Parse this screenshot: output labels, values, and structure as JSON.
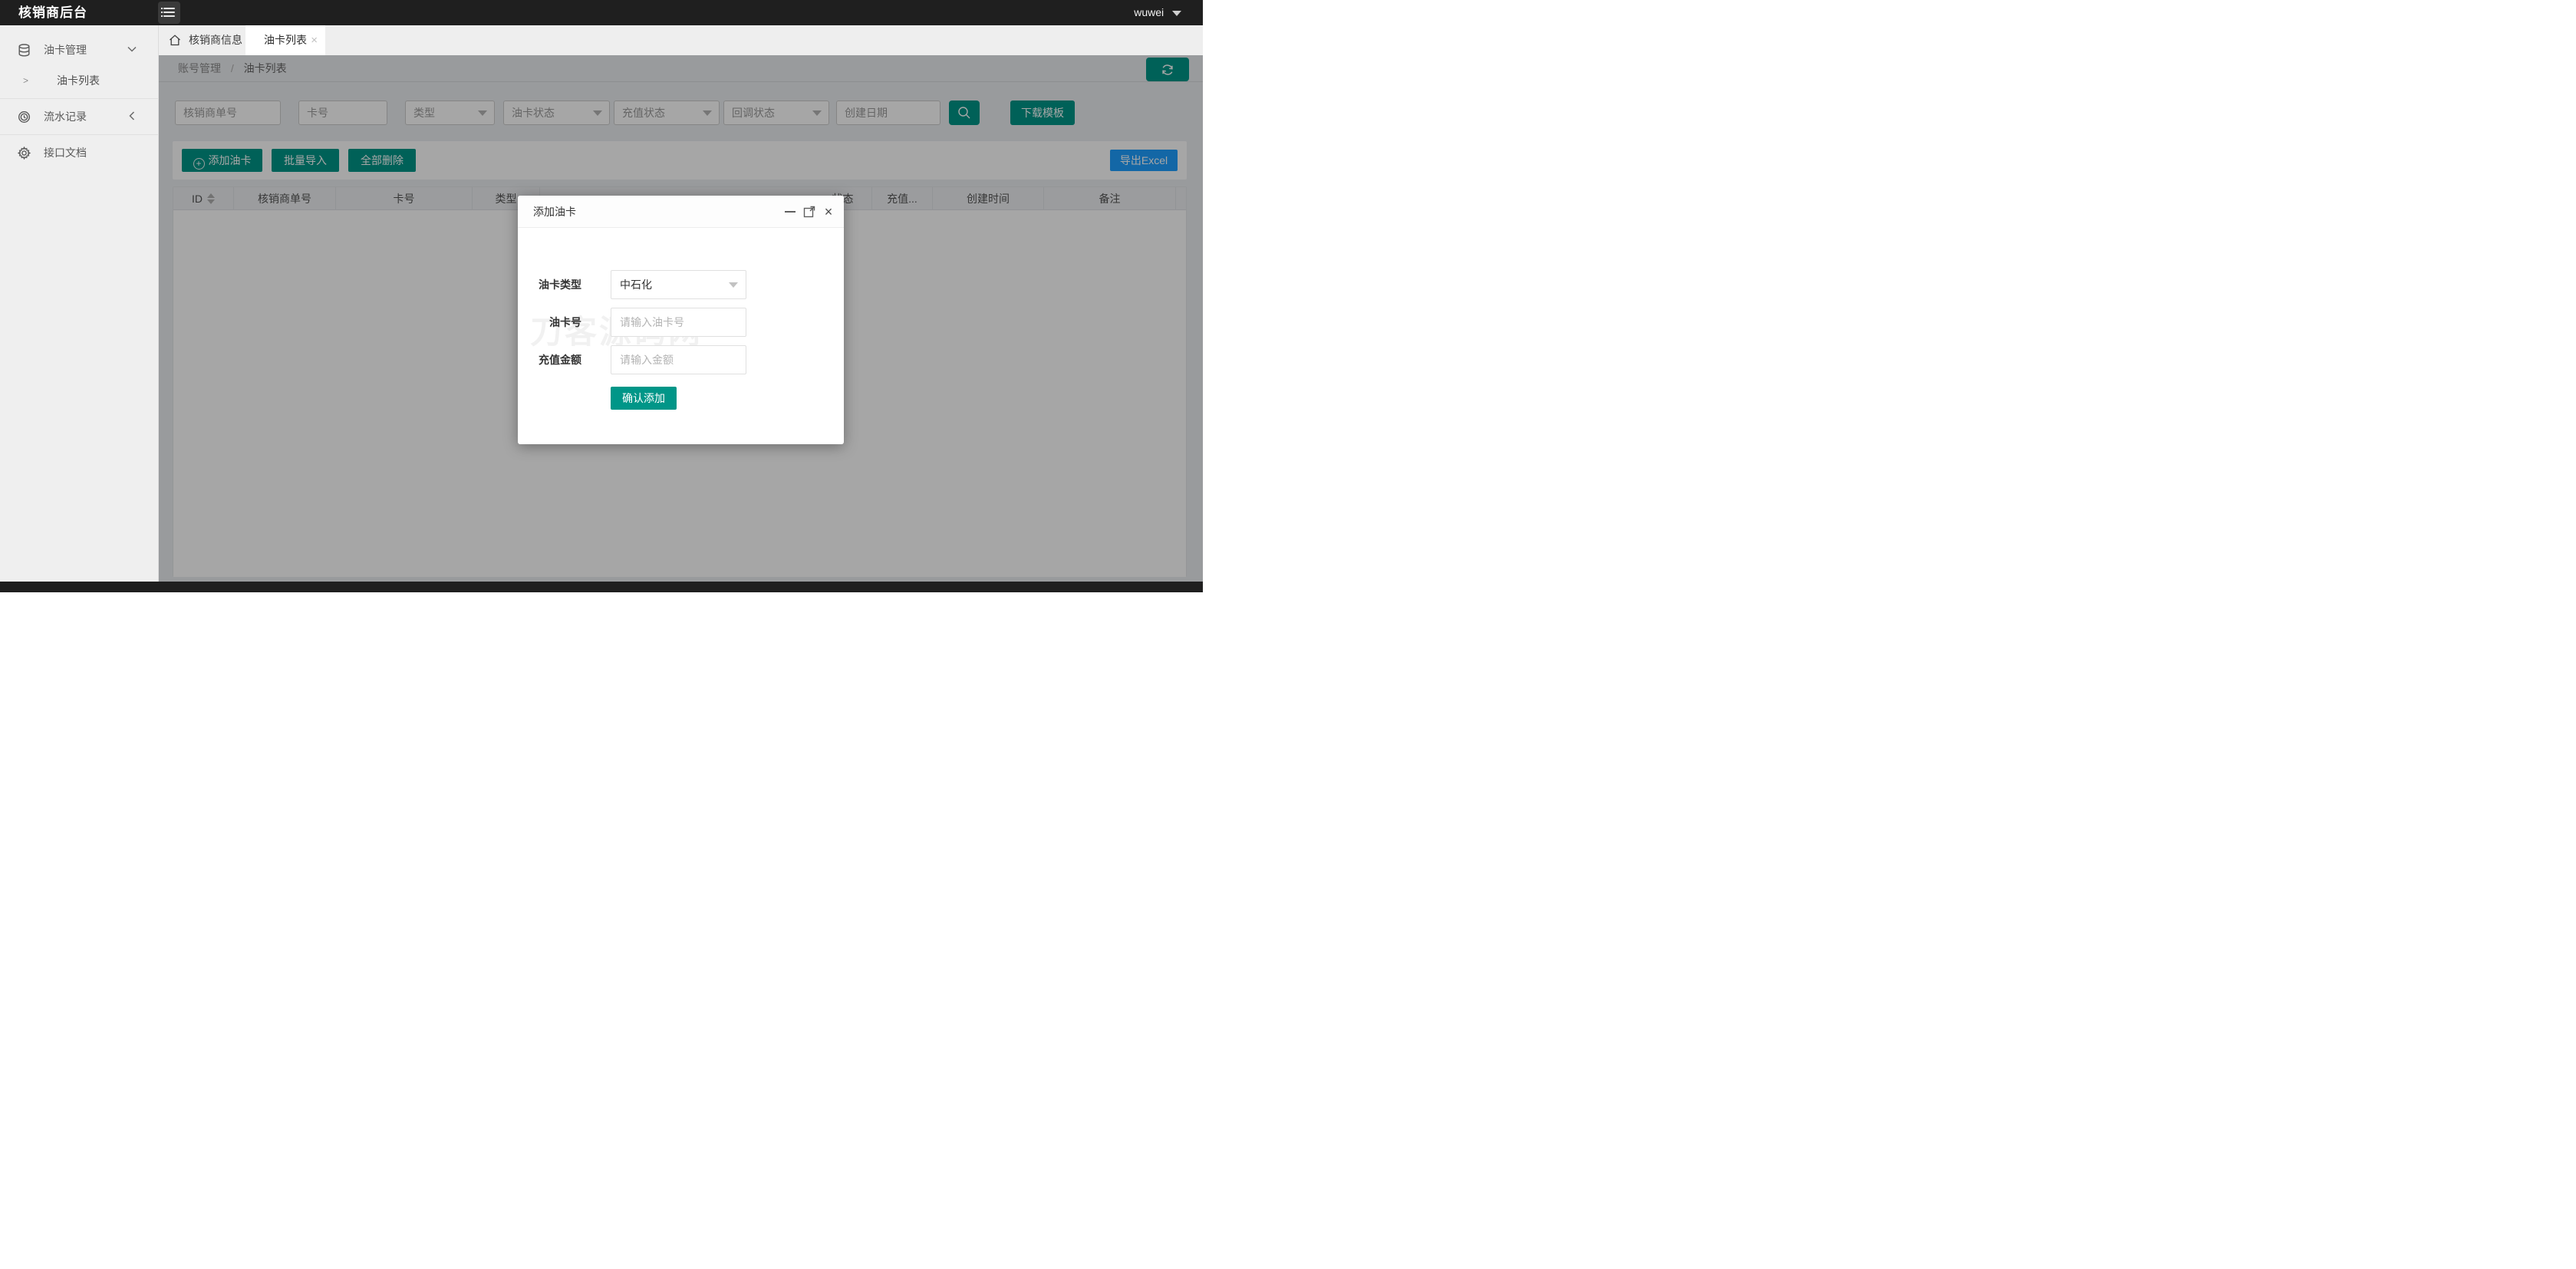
{
  "colors": {
    "topbar": "#1f1f1f",
    "teal": "#009688",
    "blue": "#1E9FFF",
    "sidebar_bg": "#efefef",
    "content_bg": "#eceef1",
    "mask": "rgba(0,0,0,0.35)"
  },
  "topbar": {
    "logo": "核销商后台",
    "menu_icon": "list-menu-icon",
    "username": "wuwei",
    "user_caret_icon": "caret-down-icon"
  },
  "sidebar": {
    "items": [
      {
        "icon": "database-icon",
        "label": "油卡管理",
        "chevron": "chevron-down",
        "expanded": true,
        "children": [
          {
            "arrow": ">",
            "label": "油卡列表"
          }
        ]
      },
      {
        "icon": "history-icon",
        "label": "流水记录",
        "chevron": "chevron-left",
        "expanded": false
      },
      {
        "icon": "gear-icon",
        "label": "接口文档",
        "chevron": "",
        "expanded": false
      }
    ]
  },
  "tabs": [
    {
      "icon": "home-icon",
      "label": "核销商信息",
      "active": false
    },
    {
      "icon": "",
      "label": "油卡列表",
      "active": true,
      "close": "×"
    }
  ],
  "breadcrumb": {
    "prev": "账号管理",
    "separator": "/",
    "current": "油卡列表",
    "refresh_icon": "refresh-icon"
  },
  "filters": {
    "merchant_no_placeholder": "核销商单号",
    "card_no_placeholder": "卡号",
    "type_placeholder": "类型",
    "card_status_placeholder": "油卡状态",
    "recharge_status_placeholder": "充值状态",
    "callback_status_placeholder": "回调状态",
    "create_date_placeholder": "创建日期",
    "search_icon": "search-icon",
    "download_template_label": "下载模板"
  },
  "toolbar": {
    "add_label": "添加油卡",
    "add_icon": "+",
    "import_label": "批量导入",
    "delete_all_label": "全部删除",
    "export_label": "导出Excel"
  },
  "table": {
    "headers": [
      {
        "label": "ID",
        "sortable": true
      },
      {
        "label": "核销商单号"
      },
      {
        "label": "卡号"
      },
      {
        "label": "类型"
      },
      {
        "label": ""
      },
      {
        "label": "状态"
      },
      {
        "label": "充值..."
      },
      {
        "label": "创建时间"
      },
      {
        "label": "备注"
      },
      {
        "label": ""
      }
    ],
    "rows": []
  },
  "modal": {
    "title": "添加油卡",
    "minimize_icon": "minimize-icon",
    "maximize_icon": "maximize-icon",
    "close_icon": "×",
    "watermark": "刀客源码网",
    "form": {
      "type_label": "油卡类型",
      "type_value": "中石化",
      "card_no_label": "油卡号",
      "card_no_placeholder": "请输入油卡号",
      "amount_label": "充值金额",
      "amount_placeholder": "请输入金额",
      "submit_label": "确认添加"
    }
  }
}
